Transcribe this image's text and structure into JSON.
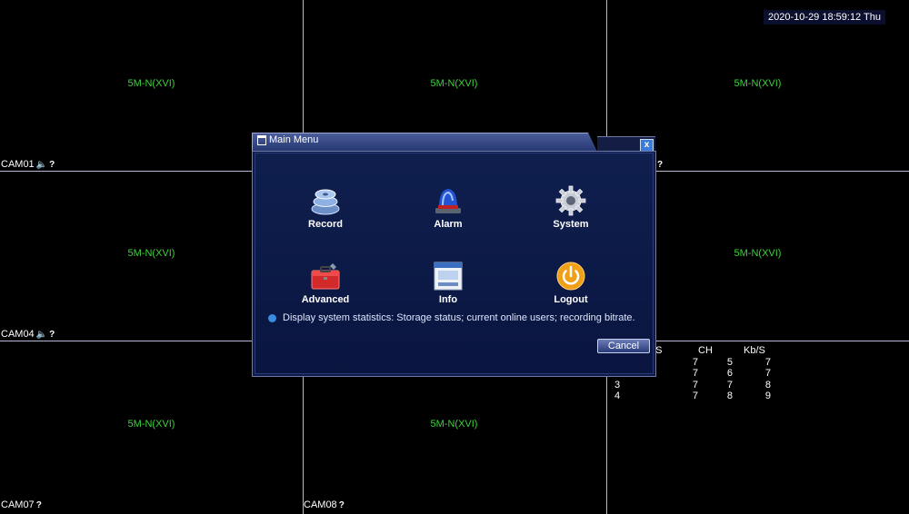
{
  "clock": "2020-10-29 18:59:12 Thu",
  "channel_text": "5M-N(XVI)",
  "cameras": {
    "cam01": "CAM01",
    "cam04": "CAM04",
    "cam07": "CAM07",
    "cam08": "CAM08"
  },
  "dialog": {
    "title": "Main Menu",
    "close_label": "x",
    "items": {
      "record": "Record",
      "alarm": "Alarm",
      "system": "System",
      "advanced": "Advanced",
      "info": "Info",
      "logout": "Logout"
    },
    "help_text": "Display system statistics: Storage status; current online users; recording bitrate.",
    "cancel_label": "Cancel"
  },
  "bitrate": {
    "headers": [
      "b/S",
      "CH",
      "Kb/S"
    ],
    "rows": [
      [
        "",
        "7",
        "5",
        "7"
      ],
      [
        "",
        "7",
        "6",
        "7"
      ],
      [
        "3",
        "7",
        "7",
        "8"
      ],
      [
        "4",
        "7",
        "8",
        "9"
      ]
    ]
  },
  "colors": {
    "channel_text": "#3cd23c",
    "grid_lines": "#b8b8d8",
    "dialog_bg": "#0c1a44"
  }
}
